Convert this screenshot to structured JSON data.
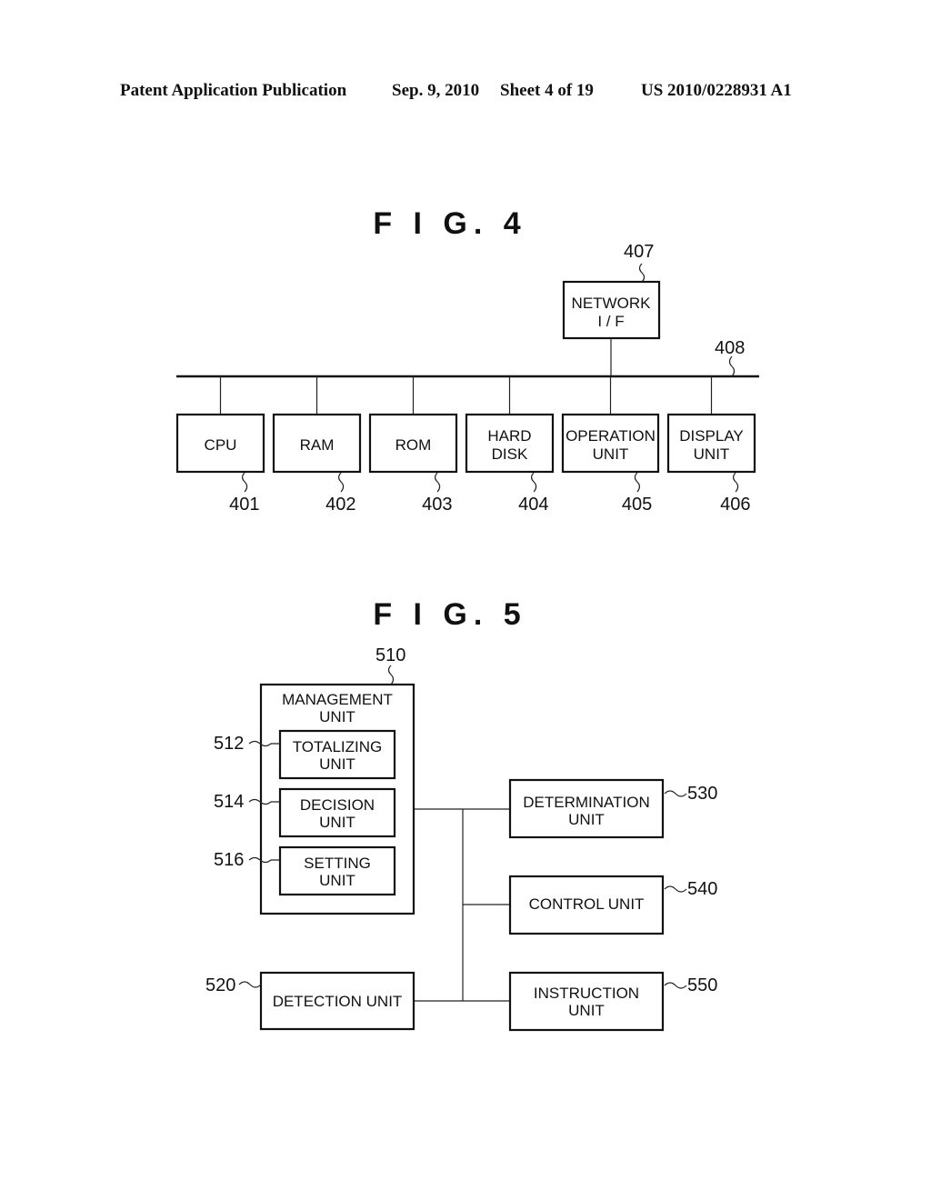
{
  "header": {
    "publication": "Patent Application Publication",
    "date": "Sep. 9, 2010",
    "sheet": "Sheet 4 of 19",
    "number": "US 2010/0228931 A1"
  },
  "fig4": {
    "title": "F I G. 4",
    "bus_ref": "408",
    "network": {
      "line1": "NETWORK",
      "line2": "I / F",
      "ref": "407"
    },
    "units": [
      {
        "line1": "CPU",
        "line2": "",
        "ref": "401"
      },
      {
        "line1": "RAM",
        "line2": "",
        "ref": "402"
      },
      {
        "line1": "ROM",
        "line2": "",
        "ref": "403"
      },
      {
        "line1": "HARD",
        "line2": "DISK",
        "ref": "404"
      },
      {
        "line1": "OPERATION",
        "line2": "UNIT",
        "ref": "405"
      },
      {
        "line1": "DISPLAY",
        "line2": "UNIT",
        "ref": "406"
      }
    ]
  },
  "fig5": {
    "title": "F I G. 5",
    "management": {
      "line1": "MANAGEMENT",
      "line2": "UNIT",
      "ref": "510"
    },
    "sub_units": [
      {
        "line1": "TOTALIZING",
        "line2": "UNIT",
        "ref": "512"
      },
      {
        "line1": "DECISION",
        "line2": "UNIT",
        "ref": "514"
      },
      {
        "line1": "SETTING",
        "line2": "UNIT",
        "ref": "516"
      }
    ],
    "detection": {
      "label": "DETECTION UNIT",
      "ref": "520"
    },
    "determination": {
      "line1": "DETERMINATION",
      "line2": "UNIT",
      "ref": "530"
    },
    "control": {
      "label": "CONTROL UNIT",
      "ref": "540"
    },
    "instruction": {
      "line1": "INSTRUCTION",
      "line2": "UNIT",
      "ref": "550"
    }
  }
}
